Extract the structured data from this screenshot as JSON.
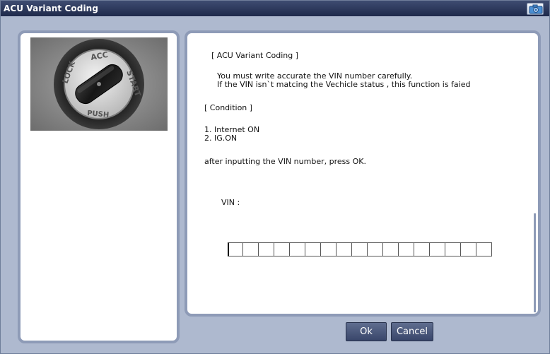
{
  "window": {
    "title": "ACU Variant Coding",
    "capture_icon": "camera-icon"
  },
  "image_panel": {
    "photo_icon": "ignition-key-switch-photo",
    "key_labels": [
      "LOCK",
      "ACC",
      "START",
      "PUSH"
    ]
  },
  "content": {
    "heading": "[ ACU Variant Coding ]",
    "warning_line1": "You must write accurate  the VIN number carefully.",
    "warning_line2": "If the VIN isn`t matcing the Vechicle status , this function is faied",
    "condition_heading": "[ Condition ]",
    "conditions": [
      "1. Internet ON",
      "2. IG.ON"
    ],
    "instruction": "after inputting the VIN number, press OK.",
    "vin_label": "VIN :",
    "vin_value": ""
  },
  "buttons": {
    "ok_label": "Ok",
    "cancel_label": "Cancel"
  },
  "colors": {
    "titlebar": "#1f2a4b",
    "frame": "#aeb9cf",
    "panel_border": "#8e9bb7",
    "button": "#3d4a6e"
  }
}
